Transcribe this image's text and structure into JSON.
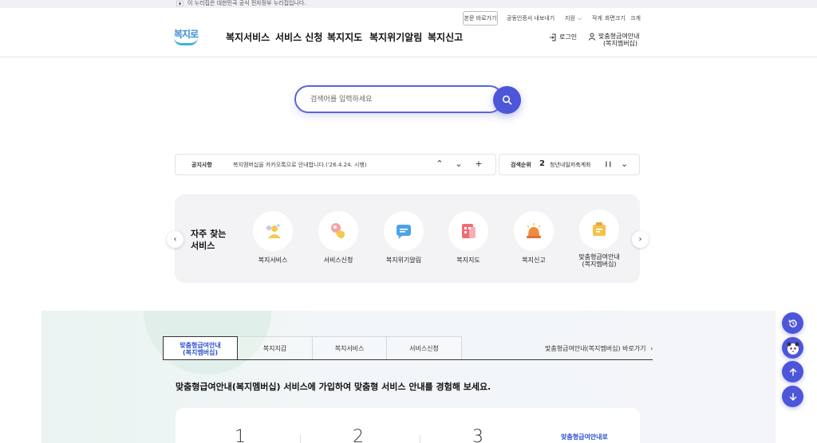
{
  "gov_bar": {
    "text": "이 누리집은 대한민국 공식 전자정부 누리집입니다."
  },
  "utility": {
    "shortcut": "본문 바로가기",
    "cert": "공동인증서 내보내기",
    "support": "지원",
    "size_small": "작게",
    "size_label": "화면크기",
    "size_large": "크게"
  },
  "header": {
    "logo": "복지로",
    "nav": [
      "복지서비스",
      "서비스 신청",
      "복지지도",
      "복지위기알림",
      "복지신고"
    ],
    "login": "로그인",
    "member_line1": "맞춤형급여안내",
    "member_line2": "(복지멤버십)"
  },
  "search": {
    "placeholder": "검색어를 입력하세요"
  },
  "notice": {
    "label": "공지사항",
    "text": "복지멤버십을 카카오톡으로 안내합니다.('26.4.24. 시행)"
  },
  "ranking": {
    "label": "검색순위",
    "number": "2",
    "text": "청년내일저축계좌"
  },
  "quick": {
    "title_line1": "자주 찾는",
    "title_line2": "서비스",
    "items": [
      {
        "label": "복지서비스",
        "icon": "people-icon",
        "color": "#f5c94a"
      },
      {
        "label": "서비스신청",
        "icon": "hand-pointer-icon",
        "color": "#f29a6a"
      },
      {
        "label": "복지위기알림",
        "icon": "chat-bubble-icon",
        "color": "#4aa3e8"
      },
      {
        "label": "복지지도",
        "icon": "map-grid-icon",
        "color": "#f06b73"
      },
      {
        "label": "복지신고",
        "icon": "alarm-siren-icon",
        "color": "#f08a3c"
      },
      {
        "label": "맞춤형급여안내\n(복지멤버십)",
        "icon": "folder-badge-icon",
        "color": "#f4c24a"
      }
    ]
  },
  "tabs": {
    "items": [
      "맞춤형급여안내\n(복지멤버십)",
      "복지지갑",
      "복지서비스",
      "서비스신청"
    ],
    "shortcut_link": "맞춤형급여안내(복지멤버십) 바로가기"
  },
  "lower": {
    "headline": "맞춤형급여안내(복지멤버십) 서비스에 가입하여 맞춤형 서비스 안내를 경험해 보세요.",
    "steps": [
      "1",
      "2",
      "3"
    ],
    "card_link": "맞춤형급여안내로"
  },
  "colors": {
    "accent": "#4d56d9",
    "active_tab": "#2d4fd0"
  }
}
